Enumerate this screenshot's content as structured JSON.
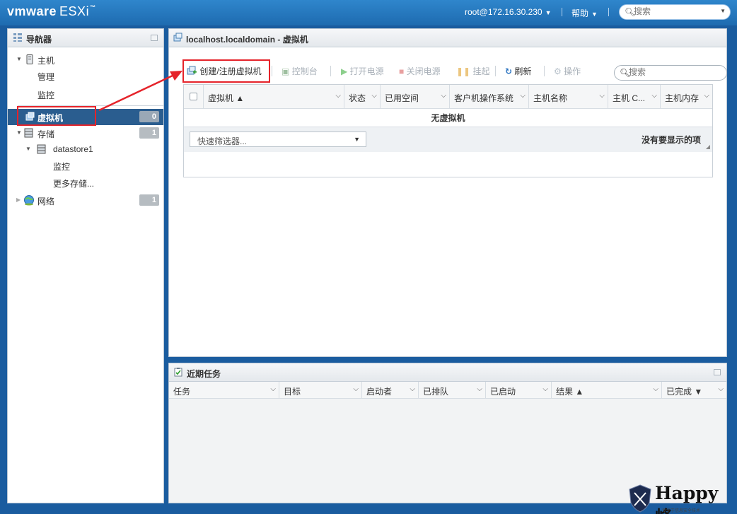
{
  "header": {
    "brand_vm": "vmware",
    "brand_esxi": "ESXi",
    "brand_tm": "™",
    "user": "root@172.16.30.230",
    "help": "帮助",
    "search_placeholder": "搜索"
  },
  "navigator": {
    "title": "导航器",
    "host": "主机",
    "host_manage": "管理",
    "host_monitor": "监控",
    "vms": "虚拟机",
    "vms_count": "0",
    "storage": "存储",
    "storage_count": "1",
    "datastore": "datastore1",
    "datastore_monitor": "监控",
    "more_storage": "更多存储...",
    "network": "网络",
    "network_count": "1"
  },
  "main": {
    "title": "localhost.localdomain - 虚拟机",
    "toolbar": {
      "create": "创建/注册虚拟机",
      "console": "控制台",
      "power_on": "打开电源",
      "power_off": "关闭电源",
      "suspend": "挂起",
      "refresh": "刷新",
      "actions": "操作",
      "search_placeholder": "搜索"
    },
    "columns": [
      "虚拟机 ▲",
      "状态",
      "已用空间",
      "客户机操作系统",
      "主机名称",
      "主机 C...",
      "主机内存"
    ],
    "empty_text": "无虚拟机",
    "quick_filter": "快速筛选器...",
    "no_items": "没有要显示的项"
  },
  "tasks": {
    "title": "近期任务",
    "columns": [
      "任务",
      "目标",
      "启动者",
      "已排队",
      "已启动",
      "结果 ▲",
      "已完成 ▼"
    ]
  },
  "watermark": {
    "text": "Happy峰",
    "sub": "专注于信息安全技术"
  },
  "colors": {
    "header": "#2f86cc",
    "selected": "#2a5d8f",
    "annotation": "#e5232a"
  }
}
